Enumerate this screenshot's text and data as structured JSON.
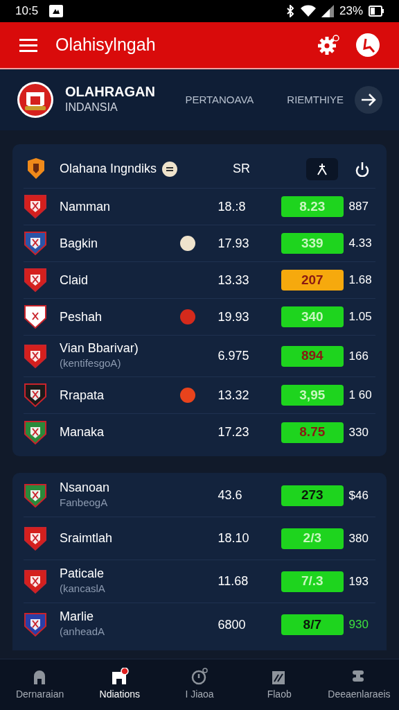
{
  "status_bar": {
    "time": "10:5",
    "battery": "23%"
  },
  "app_bar": {
    "title": "Olahisylngah"
  },
  "header": {
    "name": "OLAHRAGAN",
    "subtitle": "INDANSIA",
    "tabs": [
      {
        "label": "PERTANOAVA",
        "selected": false
      },
      {
        "label": "RIEMTHIYE",
        "selected": false
      }
    ]
  },
  "card_1": {
    "title": "Olahana Ingndiks",
    "column": "SR",
    "rows": [
      {
        "name": "Namman",
        "value": "18.:8",
        "score": {
          "text": "8.23",
          "kind": "light",
          "color": "#1ed41e"
        },
        "last": {
          "text": "887",
          "color": "#ffffff"
        }
      },
      {
        "name": "Bagkin",
        "marker": {
          "color": "#efe3cc"
        },
        "value": "17.93",
        "score": {
          "text": "339",
          "kind": "light",
          "color": "#1ed41e"
        },
        "last": {
          "text": "4.33",
          "color": "#ffffff"
        }
      },
      {
        "name": "Claid",
        "value": "13.33",
        "score": {
          "text": "207",
          "kind": "red",
          "color": "#f6a90d"
        },
        "last": {
          "text": "1.68",
          "color": "#ffffff"
        }
      },
      {
        "name": "Peshah",
        "marker": {
          "color": "#d42a1c"
        },
        "value": "19.93",
        "score": {
          "text": "340",
          "kind": "light",
          "color": "#1ed41e"
        },
        "last": {
          "text": "1.05",
          "color": "#ffffff"
        }
      },
      {
        "name": "Vian Bbarivar)",
        "sub": "(kentifesgoA)",
        "value": "6.975",
        "score": {
          "text": "894",
          "kind": "red",
          "color": "#1ed41e"
        },
        "last": {
          "text": "166",
          "color": "#ffffff"
        }
      },
      {
        "name": "Rrapata",
        "marker": {
          "color": "#e8431c"
        },
        "value": "13.32",
        "score": {
          "text": "3,95",
          "kind": "light",
          "color": "#1ed41e"
        },
        "last": {
          "text": "1 60",
          "color": "#ffffff"
        }
      },
      {
        "name": "Manaka",
        "value": "17.23",
        "score": {
          "text": "8.75",
          "kind": "red",
          "color": "#1ed41e"
        },
        "last": {
          "text": "330",
          "color": "#ffffff"
        }
      }
    ]
  },
  "card_2": {
    "rows": [
      {
        "name": "Nsanoan",
        "sub": "FanbeogA",
        "value": "43.6",
        "score": {
          "text": "273",
          "kind": "dark",
          "color": "#1ed41e"
        },
        "last": {
          "text": "$46",
          "color": "#ffffff"
        }
      },
      {
        "name": "Sraimtlah",
        "value": "18.10",
        "score": {
          "text": "2/3",
          "kind": "light",
          "color": "#1ed41e"
        },
        "last": {
          "text": "380",
          "color": "#ffffff"
        }
      },
      {
        "name": "Paticale",
        "sub": "(kancaslA",
        "value": "11.68",
        "score": {
          "text": "7/.3",
          "kind": "light",
          "color": "#1ed41e"
        },
        "last": {
          "text": "193",
          "color": "#ffffff"
        }
      },
      {
        "name": "Marlie",
        "sub": "(anheadA",
        "value": "6800",
        "score": {
          "text": "8/7",
          "kind": "dark",
          "color": "#1ed41e"
        },
        "last": {
          "text": "930",
          "color": "#3ee23e"
        }
      }
    ]
  },
  "bottom_nav": [
    {
      "label": "Dernaraian",
      "selected": false
    },
    {
      "label": "Ndiations",
      "selected": true
    },
    {
      "label": "I Jiaoa",
      "selected": false
    },
    {
      "label": "Flaob",
      "selected": false
    },
    {
      "label": "Deeaenlaraeis",
      "selected": false
    }
  ]
}
